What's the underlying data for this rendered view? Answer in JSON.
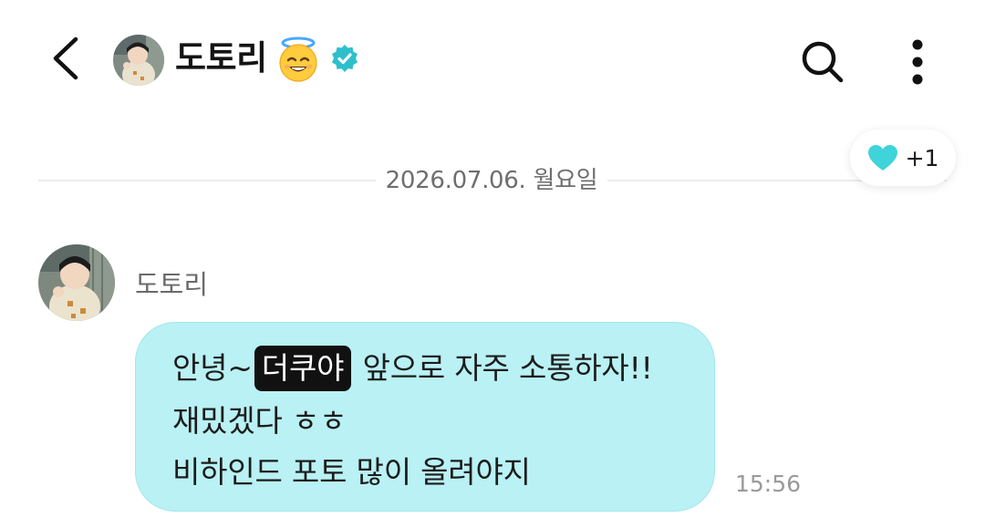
{
  "header": {
    "title": "도토리",
    "title_emoji": "😇",
    "back_icon": "chevron-left-icon",
    "search_icon": "search-icon",
    "more_icon": "more-vertical-icon",
    "verified_icon": "verified-badge-icon"
  },
  "date_divider": {
    "text": "2026.07.06. 월요일"
  },
  "reaction": {
    "icon": "heart-icon",
    "count": "+1",
    "color": "#3fd3da"
  },
  "message": {
    "sender_name": "도토리",
    "line1_prefix": "안녕~",
    "nickname": "더쿠야",
    "line1_suffix": "앞으로 자주 소통하자!!",
    "line2": "재밌겠다 ㅎㅎ",
    "line3": "비하인드 포토 많이 올려야지",
    "time": "15:56",
    "bubble_color": "#b9f1f4"
  },
  "colors": {
    "accent": "#2ec4cf",
    "badge": "#2fbfcc"
  }
}
